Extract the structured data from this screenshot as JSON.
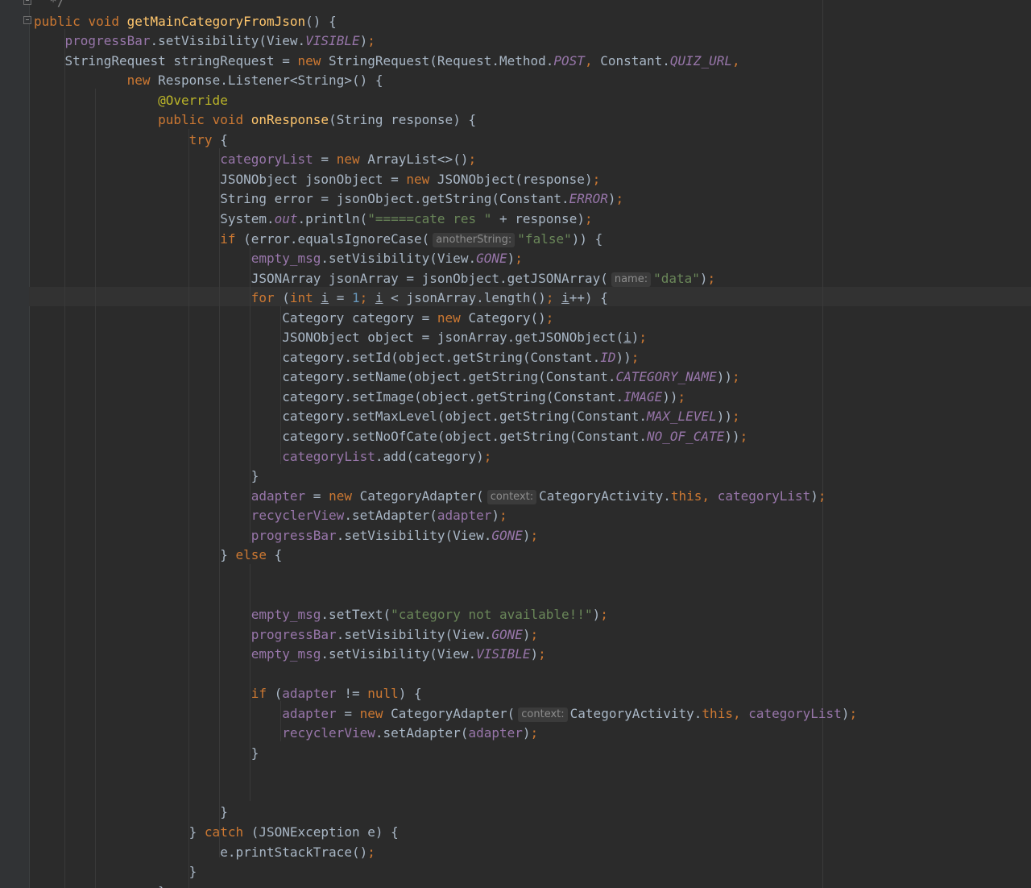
{
  "editor": {
    "language": "java",
    "colors": {
      "background": "#2b2b2b",
      "gutter": "#313335",
      "keyword": "#cc7832",
      "method_decl": "#ffc66d",
      "field": "#9876aa",
      "string": "#6a8759",
      "number": "#6897bb",
      "annotation": "#bbb529",
      "default_text": "#a9b7c6"
    },
    "icons": [
      "fold-marker-icon"
    ],
    "current_line_number": 16,
    "lines": [
      {
        "indent": "  ",
        "tokens": [
          {
            "t": "*/",
            "c": "cmt"
          }
        ]
      },
      {
        "indent": "",
        "tokens": [
          {
            "t": "public",
            "c": "kw"
          },
          {
            "t": " "
          },
          {
            "t": "void",
            "c": "kw"
          },
          {
            "t": " "
          },
          {
            "t": "getMainCategoryFromJson",
            "c": "fn"
          },
          {
            "t": "() {"
          }
        ]
      },
      {
        "indent": "    ",
        "tokens": [
          {
            "t": "progressBar",
            "c": "fld"
          },
          {
            "t": ".setVisibility(View."
          },
          {
            "t": "VISIBLE",
            "c": "stat"
          },
          {
            "t": ")"
          },
          {
            "t": ";",
            "c": "kw"
          }
        ]
      },
      {
        "indent": "    ",
        "tokens": [
          {
            "t": "StringRequest stringRequest = "
          },
          {
            "t": "new",
            "c": "kw"
          },
          {
            "t": " StringRequest(Request.Method."
          },
          {
            "t": "POST",
            "c": "stat"
          },
          {
            "t": ", ",
            "c": "kw"
          },
          {
            "t": "Constant."
          },
          {
            "t": "QUIZ_URL",
            "c": "stat"
          },
          {
            "t": ",",
            "c": "kw"
          }
        ]
      },
      {
        "indent": "            ",
        "tokens": [
          {
            "t": "new",
            "c": "kw"
          },
          {
            "t": " Response.Listener<String>() {"
          }
        ]
      },
      {
        "indent": "                ",
        "tokens": [
          {
            "t": "@Override",
            "c": "ann"
          }
        ]
      },
      {
        "indent": "                ",
        "tokens": [
          {
            "t": "public",
            "c": "kw"
          },
          {
            "t": " "
          },
          {
            "t": "void",
            "c": "kw"
          },
          {
            "t": " "
          },
          {
            "t": "onResponse",
            "c": "fn"
          },
          {
            "t": "(String response) {"
          }
        ]
      },
      {
        "indent": "                    ",
        "tokens": [
          {
            "t": "try",
            "c": "kw"
          },
          {
            "t": " {"
          }
        ]
      },
      {
        "indent": "                        ",
        "tokens": [
          {
            "t": "categoryList",
            "c": "fld"
          },
          {
            "t": " = "
          },
          {
            "t": "new",
            "c": "kw"
          },
          {
            "t": " ArrayList<>()"
          },
          {
            "t": ";",
            "c": "kw"
          }
        ]
      },
      {
        "indent": "                        ",
        "tokens": [
          {
            "t": "JSONObject jsonObject = "
          },
          {
            "t": "new",
            "c": "kw"
          },
          {
            "t": " JSONObject(response)"
          },
          {
            "t": ";",
            "c": "kw"
          }
        ]
      },
      {
        "indent": "                        ",
        "tokens": [
          {
            "t": "String error = jsonObject.getString(Constant."
          },
          {
            "t": "ERROR",
            "c": "stat"
          },
          {
            "t": ")"
          },
          {
            "t": ";",
            "c": "kw"
          }
        ]
      },
      {
        "indent": "                        ",
        "tokens": [
          {
            "t": "System."
          },
          {
            "t": "out",
            "c": "stat"
          },
          {
            "t": ".println("
          },
          {
            "t": "\"=====cate res \"",
            "c": "str"
          },
          {
            "t": " + response)"
          },
          {
            "t": ";",
            "c": "kw"
          }
        ]
      },
      {
        "indent": "                        ",
        "tokens": [
          {
            "t": "if",
            "c": "kw"
          },
          {
            "t": " (error.equalsIgnoreCase("
          },
          {
            "t": "anotherString:",
            "c": "hint"
          },
          {
            "t": "\"false\"",
            "c": "str"
          },
          {
            "t": ")) {"
          }
        ]
      },
      {
        "indent": "                            ",
        "tokens": [
          {
            "t": "empty_msg",
            "c": "fld"
          },
          {
            "t": ".setVisibility(View."
          },
          {
            "t": "GONE",
            "c": "stat"
          },
          {
            "t": ")"
          },
          {
            "t": ";",
            "c": "kw"
          }
        ]
      },
      {
        "indent": "                            ",
        "tokens": [
          {
            "t": "JSONArray jsonArray = jsonObject.getJSONArray("
          },
          {
            "t": "name:",
            "c": "hint"
          },
          {
            "t": "\"data\"",
            "c": "str"
          },
          {
            "t": ")"
          },
          {
            "t": ";",
            "c": "kw"
          }
        ]
      },
      {
        "indent": "                            ",
        "tokens": [
          {
            "t": "for",
            "c": "kw"
          },
          {
            "t": " ("
          },
          {
            "t": "int",
            "c": "kw"
          },
          {
            "t": " "
          },
          {
            "t": "i",
            "c": "ul"
          },
          {
            "t": " = "
          },
          {
            "t": "1",
            "c": "num"
          },
          {
            "t": "; ",
            "c": "kw"
          },
          {
            "t": "i",
            "c": "ul"
          },
          {
            "t": " < jsonArray.length()"
          },
          {
            "t": "; ",
            "c": "kw"
          },
          {
            "t": "i",
            "c": "ul"
          },
          {
            "t": "++) {"
          }
        ]
      },
      {
        "indent": "                                ",
        "tokens": [
          {
            "t": "Category category = "
          },
          {
            "t": "new",
            "c": "kw"
          },
          {
            "t": " Category()"
          },
          {
            "t": ";",
            "c": "kw"
          }
        ]
      },
      {
        "indent": "                                ",
        "tokens": [
          {
            "t": "JSONObject object = jsonArray.getJSONObject("
          },
          {
            "t": "i",
            "c": "ul"
          },
          {
            "t": ")"
          },
          {
            "t": ";",
            "c": "kw"
          }
        ]
      },
      {
        "indent": "                                ",
        "tokens": [
          {
            "t": "category.setId(object.getString(Constant."
          },
          {
            "t": "ID",
            "c": "stat"
          },
          {
            "t": "))"
          },
          {
            "t": ";",
            "c": "kw"
          }
        ]
      },
      {
        "indent": "                                ",
        "tokens": [
          {
            "t": "category.setName(object.getString(Constant."
          },
          {
            "t": "CATEGORY_NAME",
            "c": "stat"
          },
          {
            "t": "))"
          },
          {
            "t": ";",
            "c": "kw"
          }
        ]
      },
      {
        "indent": "                                ",
        "tokens": [
          {
            "t": "category.setImage(object.getString(Constant."
          },
          {
            "t": "IMAGE",
            "c": "stat"
          },
          {
            "t": "))"
          },
          {
            "t": ";",
            "c": "kw"
          }
        ]
      },
      {
        "indent": "                                ",
        "tokens": [
          {
            "t": "category.setMaxLevel(object.getString(Constant."
          },
          {
            "t": "MAX_LEVEL",
            "c": "stat"
          },
          {
            "t": "))"
          },
          {
            "t": ";",
            "c": "kw"
          }
        ]
      },
      {
        "indent": "                                ",
        "tokens": [
          {
            "t": "category.setNoOfCate(object.getString(Constant."
          },
          {
            "t": "NO_OF_CATE",
            "c": "stat"
          },
          {
            "t": "))"
          },
          {
            "t": ";",
            "c": "kw"
          }
        ]
      },
      {
        "indent": "                                ",
        "tokens": [
          {
            "t": "categoryList",
            "c": "fld"
          },
          {
            "t": ".add(category)"
          },
          {
            "t": ";",
            "c": "kw"
          }
        ]
      },
      {
        "indent": "                            ",
        "tokens": [
          {
            "t": "}"
          }
        ]
      },
      {
        "indent": "                            ",
        "tokens": [
          {
            "t": "adapter",
            "c": "fld"
          },
          {
            "t": " = "
          },
          {
            "t": "new",
            "c": "kw"
          },
          {
            "t": " CategoryAdapter("
          },
          {
            "t": "context:",
            "c": "hint"
          },
          {
            "t": "CategoryActivity."
          },
          {
            "t": "this",
            "c": "kw"
          },
          {
            "t": ", ",
            "c": "kw"
          },
          {
            "t": "categoryList",
            "c": "fld"
          },
          {
            "t": ")"
          },
          {
            "t": ";",
            "c": "kw"
          }
        ]
      },
      {
        "indent": "                            ",
        "tokens": [
          {
            "t": "recyclerView",
            "c": "fld"
          },
          {
            "t": ".setAdapter("
          },
          {
            "t": "adapter",
            "c": "fld"
          },
          {
            "t": ")"
          },
          {
            "t": ";",
            "c": "kw"
          }
        ]
      },
      {
        "indent": "                            ",
        "tokens": [
          {
            "t": "progressBar",
            "c": "fld"
          },
          {
            "t": ".setVisibility(View."
          },
          {
            "t": "GONE",
            "c": "stat"
          },
          {
            "t": ")"
          },
          {
            "t": ";",
            "c": "kw"
          }
        ]
      },
      {
        "indent": "                        ",
        "tokens": [
          {
            "t": "} "
          },
          {
            "t": "else",
            "c": "kw"
          },
          {
            "t": " {"
          }
        ]
      },
      {
        "indent": "",
        "tokens": []
      },
      {
        "indent": "",
        "tokens": []
      },
      {
        "indent": "                            ",
        "tokens": [
          {
            "t": "empty_msg",
            "c": "fld"
          },
          {
            "t": ".setText("
          },
          {
            "t": "\"category not available!!\"",
            "c": "str"
          },
          {
            "t": ")"
          },
          {
            "t": ";",
            "c": "kw"
          }
        ]
      },
      {
        "indent": "                            ",
        "tokens": [
          {
            "t": "progressBar",
            "c": "fld"
          },
          {
            "t": ".setVisibility(View."
          },
          {
            "t": "GONE",
            "c": "stat"
          },
          {
            "t": ")"
          },
          {
            "t": ";",
            "c": "kw"
          }
        ]
      },
      {
        "indent": "                            ",
        "tokens": [
          {
            "t": "empty_msg",
            "c": "fld"
          },
          {
            "t": ".setVisibility(View."
          },
          {
            "t": "VISIBLE",
            "c": "stat"
          },
          {
            "t": ")"
          },
          {
            "t": ";",
            "c": "kw"
          }
        ]
      },
      {
        "indent": "",
        "tokens": []
      },
      {
        "indent": "                            ",
        "tokens": [
          {
            "t": "if",
            "c": "kw"
          },
          {
            "t": " ("
          },
          {
            "t": "adapter",
            "c": "fld"
          },
          {
            "t": " != "
          },
          {
            "t": "null",
            "c": "kw"
          },
          {
            "t": ") {"
          }
        ]
      },
      {
        "indent": "                                ",
        "tokens": [
          {
            "t": "adapter",
            "c": "fld"
          },
          {
            "t": " = "
          },
          {
            "t": "new",
            "c": "kw"
          },
          {
            "t": " CategoryAdapter("
          },
          {
            "t": "context:",
            "c": "hint"
          },
          {
            "t": "CategoryActivity."
          },
          {
            "t": "this",
            "c": "kw"
          },
          {
            "t": ", ",
            "c": "kw"
          },
          {
            "t": "categoryList",
            "c": "fld"
          },
          {
            "t": ")"
          },
          {
            "t": ";",
            "c": "kw"
          }
        ]
      },
      {
        "indent": "                                ",
        "tokens": [
          {
            "t": "recyclerView",
            "c": "fld"
          },
          {
            "t": ".setAdapter("
          },
          {
            "t": "adapter",
            "c": "fld"
          },
          {
            "t": ")"
          },
          {
            "t": ";",
            "c": "kw"
          }
        ]
      },
      {
        "indent": "                            ",
        "tokens": [
          {
            "t": "}"
          }
        ]
      },
      {
        "indent": "",
        "tokens": []
      },
      {
        "indent": "",
        "tokens": []
      },
      {
        "indent": "                        ",
        "tokens": [
          {
            "t": "}"
          }
        ]
      },
      {
        "indent": "                    ",
        "tokens": [
          {
            "t": "} "
          },
          {
            "t": "catch",
            "c": "kw"
          },
          {
            "t": " (JSONException e) {"
          }
        ]
      },
      {
        "indent": "                        ",
        "tokens": [
          {
            "t": "e.printStackTrace()"
          },
          {
            "t": ";",
            "c": "kw"
          }
        ]
      },
      {
        "indent": "                    ",
        "tokens": [
          {
            "t": "}"
          }
        ]
      },
      {
        "indent": "                ",
        "tokens": [
          {
            "t": "}"
          }
        ]
      }
    ]
  }
}
